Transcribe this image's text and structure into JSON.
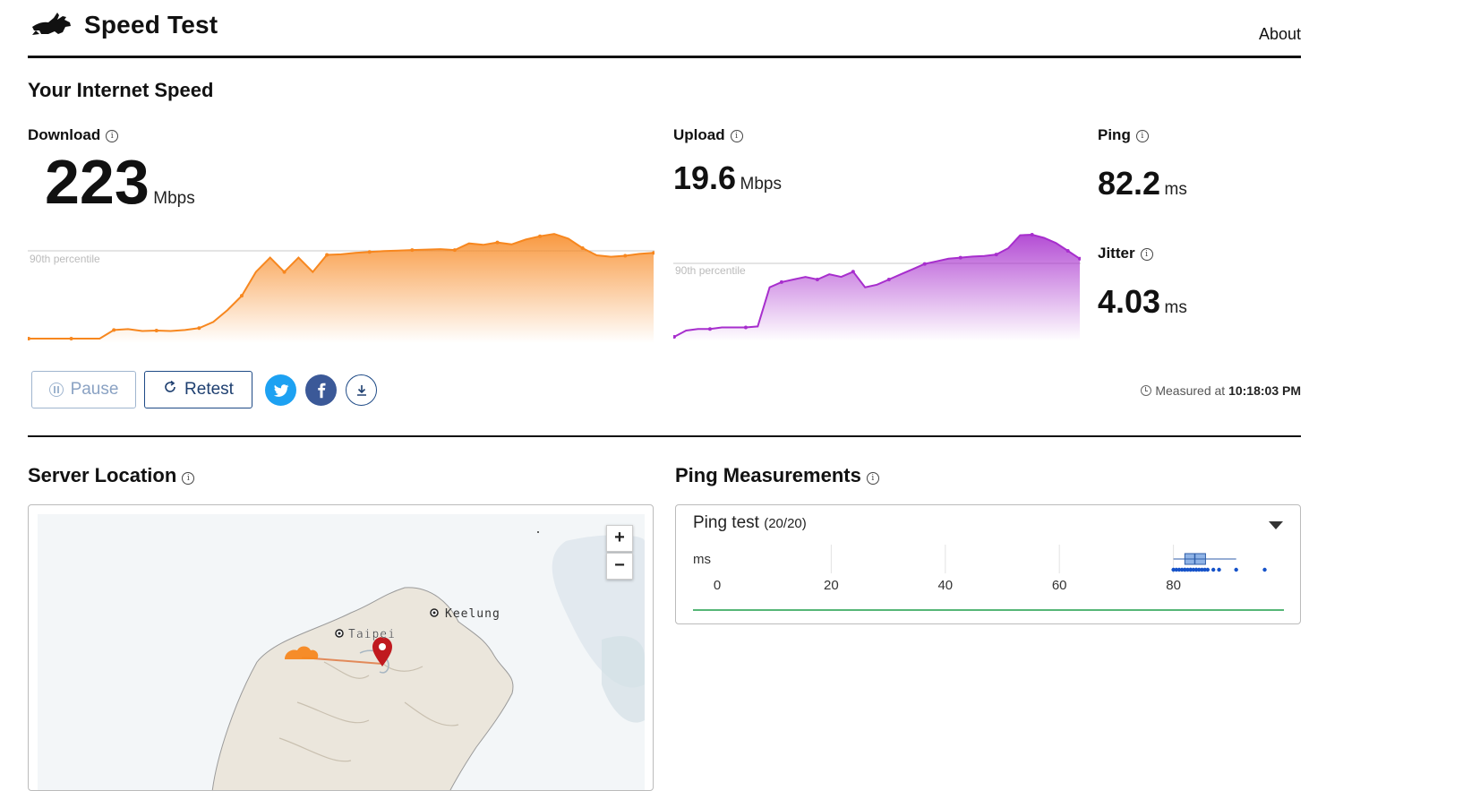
{
  "header": {
    "brand": "Speed Test",
    "about": "About"
  },
  "speed": {
    "section_title": "Your Internet Speed",
    "download": {
      "label": "Download",
      "value": "223",
      "unit": "Mbps"
    },
    "upload": {
      "label": "Upload",
      "value": "19.6",
      "unit": "Mbps"
    },
    "ping": {
      "label": "Ping",
      "value": "82.2",
      "unit": "ms"
    },
    "jitter": {
      "label": "Jitter",
      "value": "4.03",
      "unit": "ms"
    },
    "percentile_label": "90th percentile",
    "colors": {
      "download": "#f7871f",
      "upload": "#a72ecd"
    }
  },
  "actions": {
    "pause": "Pause",
    "retest": "Retest",
    "twitter_icon": "twitter-icon",
    "facebook_icon": "facebook-icon",
    "download_icon": "download-icon"
  },
  "measured": {
    "prefix": "Measured at",
    "time": "10:18:03 PM"
  },
  "server_location": {
    "title": "Server Location",
    "zoom_in": "+",
    "zoom_out": "−",
    "cities": {
      "keelung": "Keelung",
      "taipei": "Taipei"
    }
  },
  "ping_measurements": {
    "title": "Ping Measurements",
    "test_label": "Ping test",
    "test_count": "(20/20)",
    "axis_unit": "ms",
    "ticks": [
      "0",
      "20",
      "40",
      "60",
      "80"
    ]
  },
  "chart_data": [
    {
      "type": "area",
      "series": [
        {
          "values": [
            0,
            0,
            0,
            0,
            0,
            0,
            18,
            20,
            16,
            17,
            16,
            18,
            22,
            35,
            60,
            90,
            140,
            170,
            140,
            170,
            140,
            176,
            177,
            180,
            182,
            184,
            185,
            186,
            187,
            188,
            186,
            200,
            197,
            202,
            198,
            208,
            215,
            220,
            210,
            190,
            175,
            172,
            174,
            178,
            180
          ]
        }
      ],
      "reference_line": {
        "label": "90th percentile"
      }
    },
    {
      "type": "area",
      "series": [
        {
          "values": [
            0,
            1.2,
            1.5,
            1.5,
            1.8,
            1.8,
            1.8,
            2,
            9.5,
            10.5,
            11,
            11.5,
            11,
            12,
            11.5,
            12.5,
            9.5,
            10,
            11,
            12,
            13,
            14,
            14.5,
            15,
            15.2,
            15.4,
            15.5,
            15.8,
            17,
            19.5,
            19.6,
            19,
            18,
            16.5,
            15
          ]
        }
      ],
      "reference_line": {
        "label": "90th percentile"
      }
    },
    {
      "type": "scatter",
      "xlabel": "ms",
      "xlim": [
        0,
        90
      ],
      "x_ticks": [
        0,
        20,
        40,
        60,
        80
      ],
      "values": [
        80,
        80.5,
        81,
        81.5,
        82,
        82,
        82.5,
        83,
        83,
        83.5,
        84,
        84,
        84.5,
        85,
        85.5,
        86,
        87,
        88,
        91,
        96
      ]
    }
  ]
}
